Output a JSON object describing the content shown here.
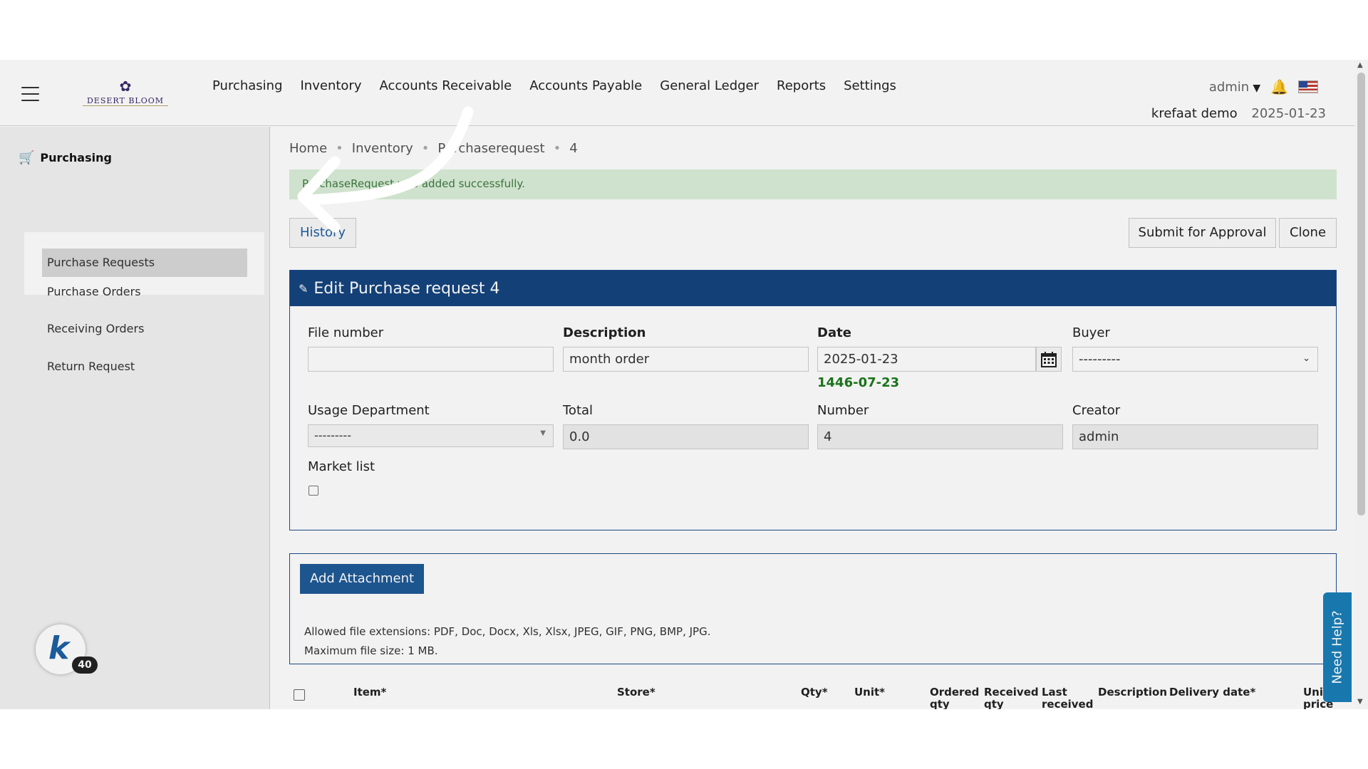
{
  "header": {
    "logo_name": "DESERT BLOOM",
    "nav": [
      "Purchasing",
      "Inventory",
      "Accounts Receivable",
      "Accounts Payable",
      "General Ledger",
      "Reports",
      "Settings"
    ],
    "user": "admin",
    "company": "krefaat demo",
    "date": "2025-01-23"
  },
  "sidebar": {
    "section": "Purchasing",
    "items": [
      "Purchase Requests",
      "Purchase Orders",
      "Receiving Orders",
      "Return Request"
    ],
    "badge_count": "40",
    "badge_letter": "k"
  },
  "breadcrumb": [
    "Home",
    "Inventory",
    "Purchaserequest",
    "4"
  ],
  "alert": "PurchaseRequest was added successfully.",
  "buttons": {
    "history": "History",
    "submit": "Submit for Approval",
    "clone": "Clone",
    "add_attachment": "Add Attachment"
  },
  "form": {
    "title": "Edit Purchase request 4",
    "file_number_label": "File number",
    "file_number_value": "",
    "description_label": "Description",
    "description_value": "month order",
    "date_label": "Date",
    "date_value": "2025-01-23",
    "hijri_date": "1446-07-23",
    "buyer_label": "Buyer",
    "buyer_value": "---------",
    "usage_department_label": "Usage Department",
    "usage_department_value": "---------",
    "total_label": "Total",
    "total_value": "0.0",
    "number_label": "Number",
    "number_value": "4",
    "creator_label": "Creator",
    "creator_value": "admin",
    "market_list_label": "Market list"
  },
  "attachments": {
    "allowed": "Allowed file extensions: PDF, Doc, Docx, Xls, Xlsx, JPEG, GIF, PNG, BMP, JPG.",
    "max_size": "Maximum file size: 1 MB."
  },
  "table": {
    "headers": [
      "Item*",
      "Store*",
      "Qty*",
      "Unit*",
      "Ordered qty",
      "Received qty",
      "Last received",
      "Description",
      "Delivery date*",
      "Unit price"
    ]
  },
  "help": "Need Help?",
  "colors": {
    "primary": "#15447e",
    "success_text": "#3f7a3f",
    "hijri": "#1c7a1c",
    "help_tab": "#1a7fb8"
  }
}
